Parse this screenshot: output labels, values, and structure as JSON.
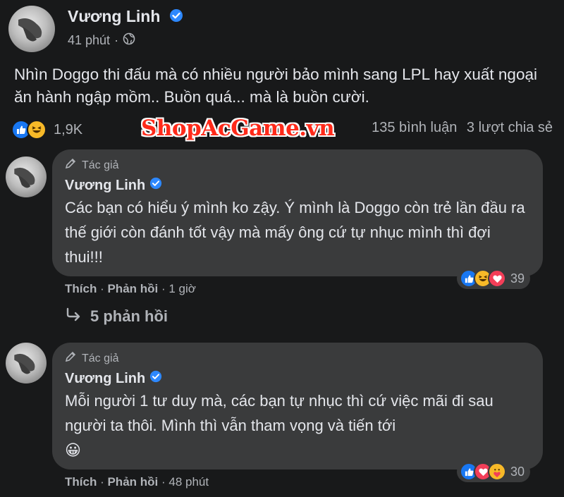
{
  "post": {
    "author": "Vương Linh",
    "time": "41 phút",
    "text": "Nhìn Doggo thi đấu mà có nhiều người bảo mình sang LPL hay xuất ngoại ăn hành ngập mồm.. Buồn quá... mà là buồn cười.",
    "reaction_count": "1,9K",
    "comments_count": "135 bình luận",
    "shares_count": "3 lượt chia sẻ"
  },
  "watermark": "ShopAcGame.vn",
  "comments": [
    {
      "author_tag": "Tác giả",
      "author": "Vương Linh",
      "text": "Các bạn có hiểu ý mình ko zậy. Ý mình là Doggo còn trẻ lần đầu ra thế giới còn đánh tốt vậy mà mấy ông cứ tự nhục mình thì đợi thui!!!",
      "like_label": "Thích",
      "reply_label": "Phản hồi",
      "time": "1 giờ",
      "reaction_count": "39"
    },
    {
      "author_tag": "Tác giả",
      "author": "Vương Linh",
      "text": "Mỗi người 1 tư duy mà, các bạn tự nhục thì cứ việc mãi đi sau người ta thôi. Mình thì vẫn tham vọng và tiến tới",
      "emoji": "😀",
      "like_label": "Thích",
      "reply_label": "Phản hồi",
      "time": "48 phút",
      "reaction_count": "30"
    }
  ],
  "replies_link": "5 phản hồi",
  "colors": {
    "background": "#18191a",
    "bubble": "#3a3b3c",
    "primary_text": "#e4e6eb",
    "secondary_text": "#b0b3b8",
    "verified": "#2d88ff",
    "like": "#1877f2",
    "love": "#f33e58",
    "haha": "#f7b928",
    "watermark": "#ff2a1a"
  },
  "icons": [
    "avatar",
    "verified-icon",
    "globe-icon",
    "like-icon",
    "haha-icon",
    "love-icon",
    "care-icon",
    "pencil-icon",
    "reply-arrow-icon"
  ]
}
